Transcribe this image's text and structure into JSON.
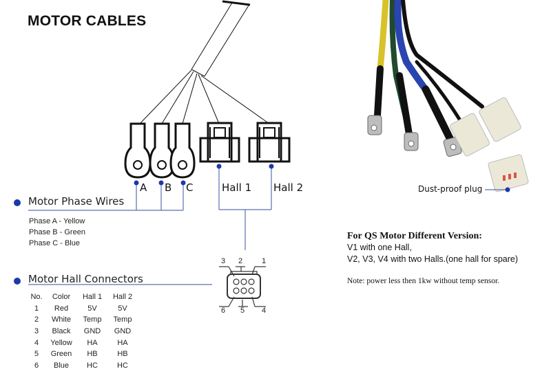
{
  "title": "MOTOR CABLES",
  "diagram": {
    "phase_labels": [
      "A",
      "B",
      "C"
    ],
    "hall_labels": [
      "Hall 1",
      "Hall 2"
    ],
    "pin_numbers": {
      "top": [
        "3",
        "2",
        "1"
      ],
      "bottom": [
        "6",
        "5",
        "4"
      ]
    }
  },
  "phase_section": {
    "heading": "Motor Phase Wires",
    "items": [
      "Phase A - Yellow",
      "Phase B - Green",
      "Phase C - Blue"
    ]
  },
  "hall_section": {
    "heading": "Motor Hall Connectors",
    "columns": [
      "No.",
      "Color",
      "Hall 1",
      "Hall 2"
    ],
    "rows": [
      [
        "1",
        "Red",
        "5V",
        "5V"
      ],
      [
        "2",
        "White",
        "Temp",
        "Temp"
      ],
      [
        "3",
        "Black",
        "GND",
        "GND"
      ],
      [
        "4",
        "Yellow",
        "HA",
        "HA"
      ],
      [
        "5",
        "Green",
        "HB",
        "HB"
      ],
      [
        "6",
        "Blue",
        "HC",
        "HC"
      ]
    ]
  },
  "photo": {
    "caption": "Dust-proof plug",
    "wire_colors": {
      "yellow": "#d8c22a",
      "green": "#1f4a2e",
      "blue": "#2a44b0",
      "black": "#111111"
    }
  },
  "version_note": {
    "heading": "For QS Motor Different Version:",
    "lines": [
      "V1 with one Hall,",
      "V2, V3, V4 with two Halls.(one hall for spare)"
    ],
    "note": "Note: power less then 1kw without temp sensor."
  },
  "colors": {
    "accent": "#1a3aa8",
    "line": "#5b6fb0"
  }
}
